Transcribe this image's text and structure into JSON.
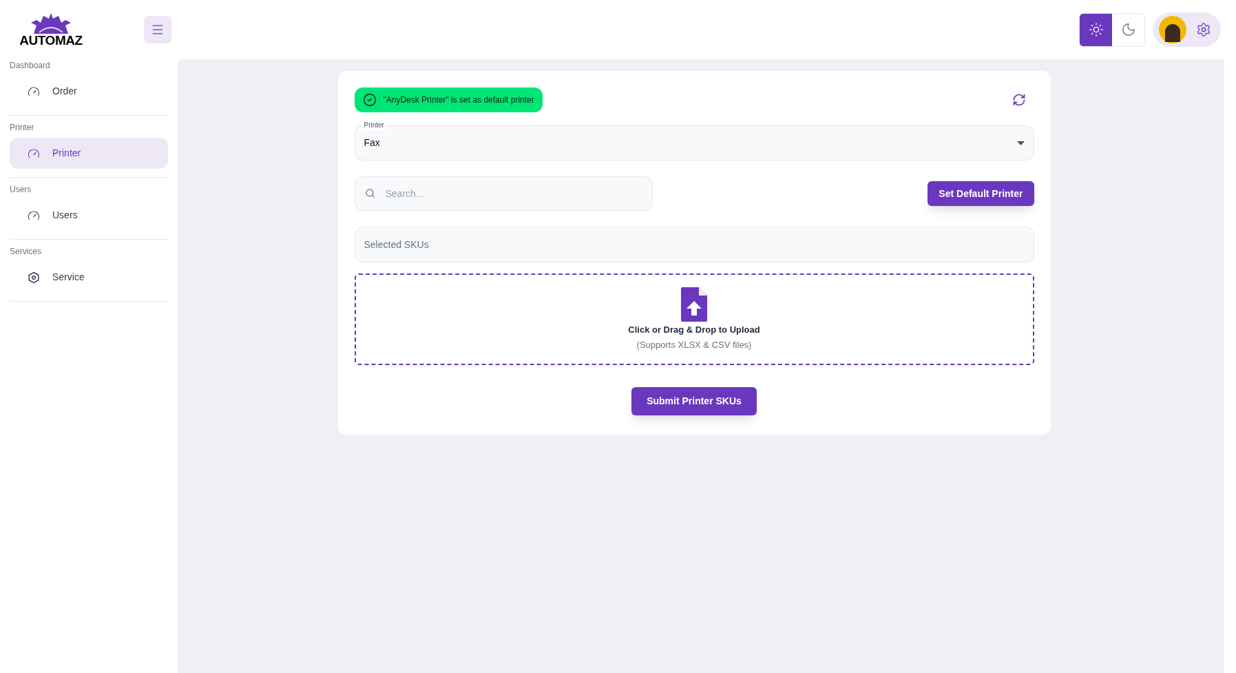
{
  "brand": {
    "name": "AUTOMAZ"
  },
  "sidebar": {
    "sections": [
      {
        "title": "Dashboard",
        "items": [
          {
            "label": "Order",
            "kind": "gauge",
            "selected": false
          }
        ]
      },
      {
        "title": "Printer",
        "items": [
          {
            "label": "Printer",
            "kind": "gauge",
            "selected": true
          }
        ]
      },
      {
        "title": "Users",
        "items": [
          {
            "label": "Users",
            "kind": "gauge",
            "selected": false
          }
        ]
      },
      {
        "title": "Services",
        "items": [
          {
            "label": "Service",
            "kind": "hexagon",
            "selected": false
          }
        ]
      }
    ]
  },
  "theme_toggle": [
    {
      "kind": "light",
      "selected": true
    },
    {
      "kind": "dark",
      "selected": false
    }
  ],
  "alert": {
    "text": "\"AnyDesk Printer\" is set as default printer"
  },
  "printer_select": {
    "label": "Printer",
    "value": "Fax"
  },
  "search": {
    "placeholder": "Search..."
  },
  "set_default_button": "Set Default Printer",
  "selected_skus": {
    "placeholder": "Selected SKUs"
  },
  "upload": {
    "title": "Click or Drag & Drop to Upload",
    "hint": "(Supports XLSX & CSV files)"
  },
  "submit_button": "Submit Printer SKUs"
}
